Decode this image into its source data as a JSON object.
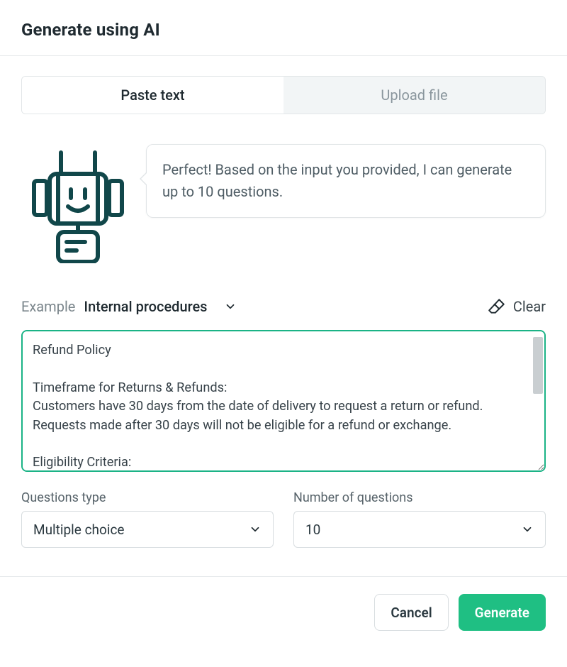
{
  "header": {
    "title": "Generate using AI"
  },
  "tabs": {
    "paste_text": "Paste text",
    "upload_file": "Upload file",
    "active": "paste_text"
  },
  "bot": {
    "message": "Perfect! Based on the input you provided, I can generate up to 10 questions."
  },
  "example": {
    "label": "Example",
    "selected": "Internal procedures"
  },
  "clear_label": "Clear",
  "textarea": {
    "value": "Refund Policy\n\nTimeframe for Returns & Refunds:\nCustomers have 30 days from the date of delivery to request a return or refund. Requests made after 30 days will not be eligible for a refund or exchange.\n\nEligibility Criteria:\nTo be eligible for a return or refund, the item must be:"
  },
  "options": {
    "question_type": {
      "label": "Questions type",
      "value": "Multiple choice"
    },
    "number": {
      "label": "Number of questions",
      "value": "10"
    }
  },
  "footer": {
    "cancel": "Cancel",
    "generate": "Generate"
  },
  "colors": {
    "accent": "#1fbf83",
    "border_focus": "#1bb386"
  }
}
